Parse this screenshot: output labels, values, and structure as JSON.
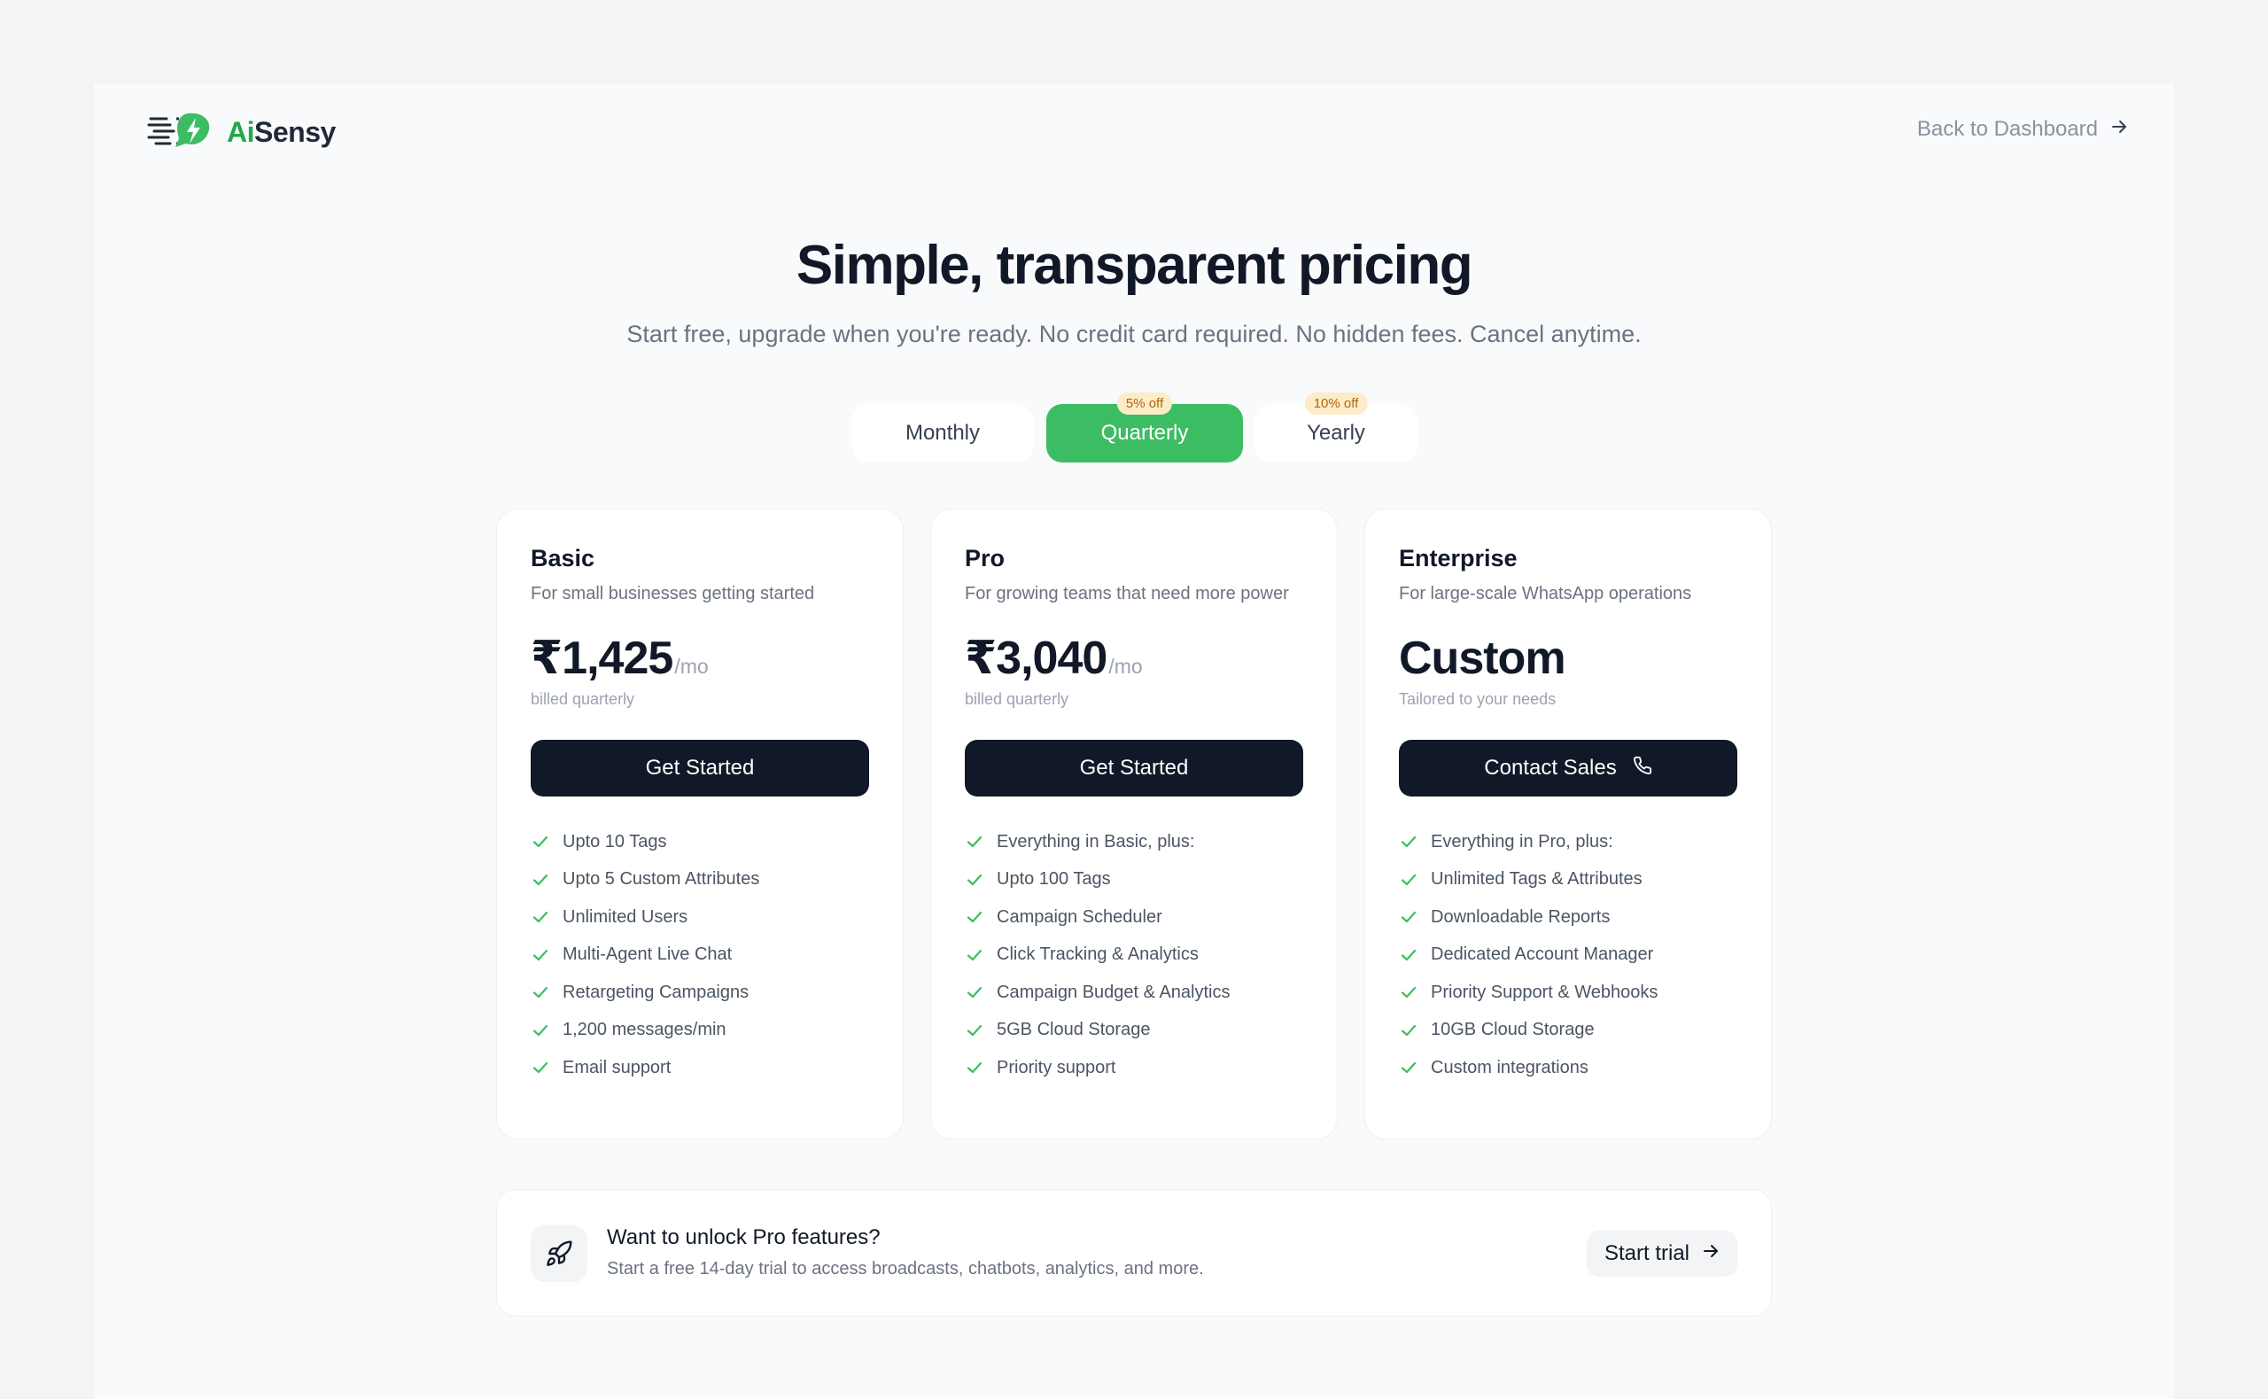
{
  "brand": {
    "logo_ai": "Ai",
    "logo_sensy": "Sensy",
    "accent": "#3dbd63",
    "dark": "#111827"
  },
  "nav": {
    "back_label": "Back to Dashboard"
  },
  "hero": {
    "title": "Simple, transparent pricing",
    "subtitle": "Start free, upgrade when you're ready. No credit card required. No hidden fees. Cancel anytime."
  },
  "billing": {
    "selected": "Quarterly",
    "options": [
      {
        "label": "Monthly",
        "badge": ""
      },
      {
        "label": "Quarterly",
        "badge": "5% off"
      },
      {
        "label": "Yearly",
        "badge": "10% off"
      }
    ]
  },
  "plans": [
    {
      "name": "Basic",
      "description": "For small businesses getting started",
      "price": "₹1,425",
      "period": "/mo",
      "note": "billed quarterly",
      "cta": "Get Started",
      "features": [
        "Upto 10 Tags",
        "Upto 5 Custom Attributes",
        "Unlimited Users",
        "Multi-Agent Live Chat",
        "Retargeting Campaigns",
        "1,200 messages/min",
        "Email support"
      ]
    },
    {
      "name": "Pro",
      "description": "For growing teams that need more power",
      "price": "₹3,040",
      "period": "/mo",
      "note": "billed quarterly",
      "cta": "Get Started",
      "features": [
        "Everything in Basic, plus:",
        "Upto 100 Tags",
        "Campaign Scheduler",
        "Click Tracking & Analytics",
        "Campaign Budget & Analytics",
        "5GB Cloud Storage",
        "Priority support"
      ]
    },
    {
      "name": "Enterprise",
      "description": "For large-scale WhatsApp operations",
      "price": "Custom",
      "period": "",
      "note": "Tailored to your needs",
      "cta": "Contact Sales",
      "features": [
        "Everything in Pro, plus:",
        "Unlimited Tags & Attributes",
        "Downloadable Reports",
        "Dedicated Account Manager",
        "Priority Support & Webhooks",
        "10GB Cloud Storage",
        "Custom integrations"
      ]
    }
  ],
  "trial": {
    "title": "Want to unlock Pro features?",
    "subtitle": "Start a free 14-day trial to access broadcasts, chatbots, analytics, and more.",
    "button": "Start trial"
  },
  "icons": {
    "logo": "aisensy-logo-icon",
    "back": "arrow-right-icon",
    "check": "check-icon",
    "phone": "phone-icon",
    "rocket": "rocket-icon",
    "trial_arrow": "arrow-right-icon"
  }
}
